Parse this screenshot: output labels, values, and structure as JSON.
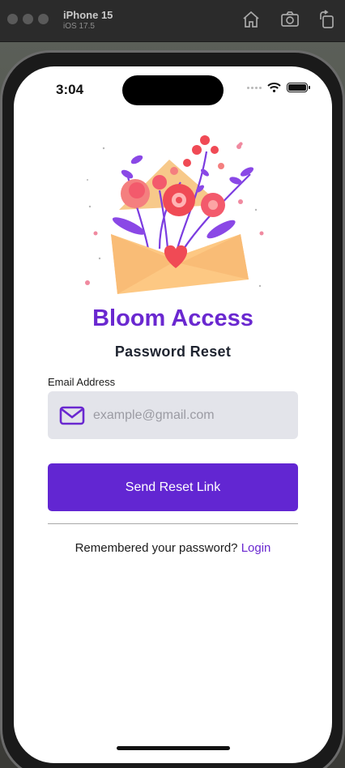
{
  "simulator": {
    "device": "iPhone 15",
    "os": "iOS 17.5",
    "toolbar_icons": [
      "home-icon",
      "camera-icon",
      "rotate-icon"
    ]
  },
  "status_bar": {
    "time": "3:04"
  },
  "app": {
    "title": "Bloom Access",
    "subtitle": "Password Reset"
  },
  "form": {
    "email_label": "Email Address",
    "email_placeholder": "example@gmail.com",
    "email_value": "",
    "submit_label": "Send Reset Link"
  },
  "footer": {
    "prompt": "Remembered your password?",
    "link_label": "Login"
  },
  "colors": {
    "accent": "#6226d2",
    "title": "#6a28d0",
    "input_bg": "#e3e4ea"
  }
}
